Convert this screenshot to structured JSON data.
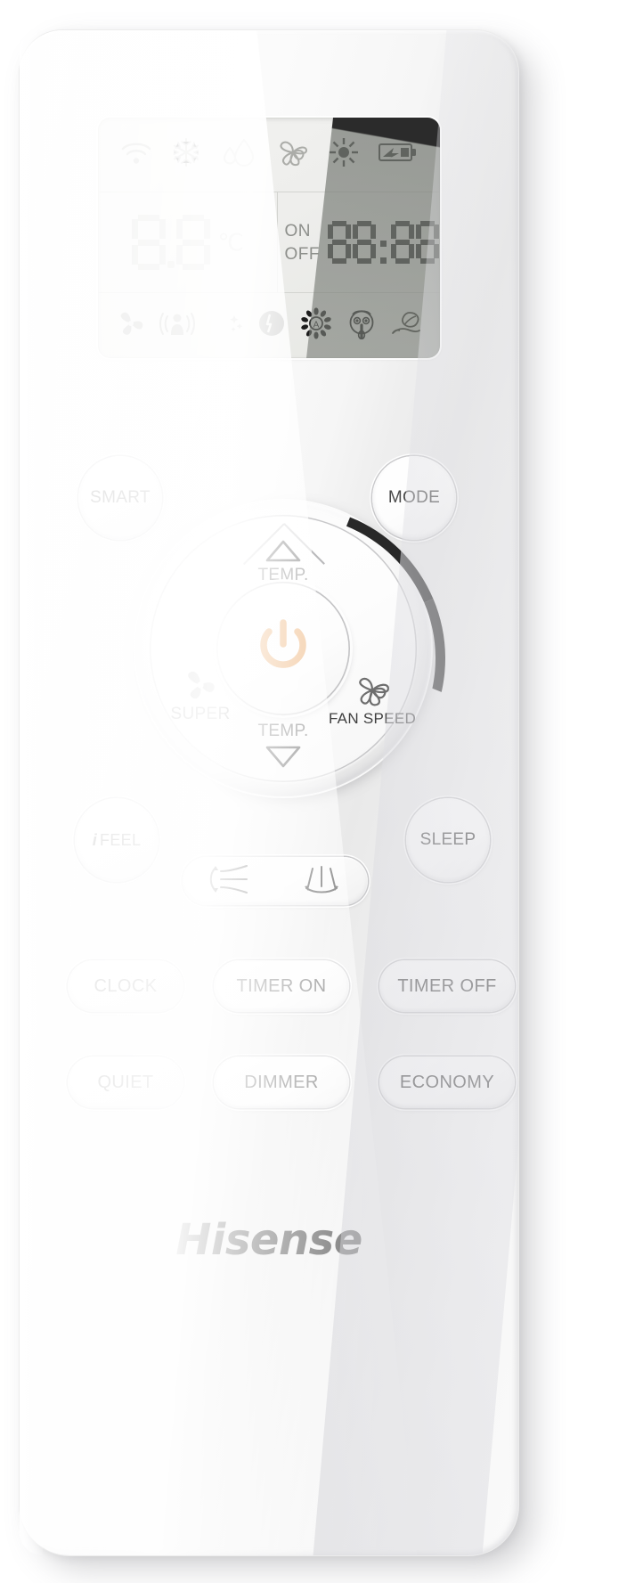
{
  "device": {
    "brand": "Hisense",
    "type": "air-conditioner-remote-control"
  },
  "lcd": {
    "status_icons": [
      {
        "name": "wifi-icon",
        "label": "WiFi"
      },
      {
        "name": "snowflake-cool-icon",
        "label": "Cool"
      },
      {
        "name": "water-drop-dry-icon",
        "label": "Dry"
      },
      {
        "name": "fan-icon",
        "label": "Fan"
      },
      {
        "name": "sun-heat-icon",
        "label": "Heat"
      },
      {
        "name": "battery-icon",
        "label": "Battery"
      }
    ],
    "temperature": {
      "digits": "88",
      "unit": "℃"
    },
    "timer": {
      "on_label": "ON",
      "off_label": "OFF",
      "value": "88:88"
    },
    "function_icons": [
      {
        "name": "super-turbo-icon",
        "label": "Super"
      },
      {
        "name": "ifeel-icon",
        "label": "i Feel"
      },
      {
        "name": "sleep-moon-icon",
        "label": "Sleep"
      },
      {
        "name": "clock-icon",
        "label": "Clock"
      },
      {
        "name": "auto-fan-icon",
        "label": "Auto Fan"
      },
      {
        "name": "quiet-icon",
        "label": "Quiet"
      },
      {
        "name": "economy-icon",
        "label": "Economy"
      }
    ]
  },
  "buttons": {
    "smart": "SMART",
    "mode": "MODE",
    "temp_up": "TEMP.",
    "temp_down": "TEMP.",
    "super": "SUPER",
    "fan_speed": "FAN SPEED",
    "power": "",
    "ifeel_i": "i",
    "ifeel": "FEEL",
    "sleep": "SLEEP",
    "swing_vertical": "vertical-swing-icon",
    "swing_horizontal": "horizontal-swing-icon",
    "clock": "CLOCK",
    "timer_on": "TIMER ON",
    "timer_off": "TIMER OFF",
    "quiet": "QUIET",
    "dimmer": "DIMMER",
    "economy": "ECONOMY"
  },
  "colors": {
    "power_accent": "#E3862B",
    "body": "#f7f7f7",
    "lcd_bg": "#eeeeec",
    "text": "#4a4a4a",
    "segment_light": "#bcbdb9",
    "segment_dark": "#2e2e2e"
  }
}
